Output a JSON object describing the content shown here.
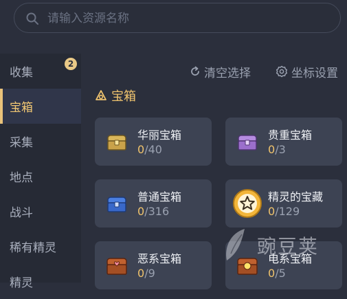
{
  "search": {
    "placeholder": "请输入资源名称",
    "value": ""
  },
  "sidebar": {
    "items": [
      {
        "label": "收集",
        "badge": "2"
      },
      {
        "label": "宝箱"
      },
      {
        "label": "采集"
      },
      {
        "label": "地点"
      },
      {
        "label": "战斗"
      },
      {
        "label": "稀有精灵"
      },
      {
        "label": "精灵"
      }
    ],
    "active_index": 1
  },
  "toolbar": {
    "clear_label": "清空选择",
    "coords_label": "坐标设置"
  },
  "section": {
    "title": "宝箱"
  },
  "cards": [
    {
      "name": "华丽宝箱",
      "found": "0",
      "total": "/40",
      "icon": "gold-chest-icon"
    },
    {
      "name": "贵重宝箱",
      "found": "0",
      "total": "/3",
      "icon": "purple-chest-icon"
    },
    {
      "name": "普通宝箱",
      "found": "0",
      "total": "/316",
      "icon": "blue-chest-icon"
    },
    {
      "name": "精灵的宝藏",
      "found": "0",
      "total": "/129",
      "icon": "star-coin-icon"
    },
    {
      "name": "恶系宝箱",
      "found": "0",
      "total": "/9",
      "icon": "dark-chest-icon"
    },
    {
      "name": "电系宝箱",
      "found": "0",
      "total": "/5",
      "icon": "electric-chest-icon"
    }
  ],
  "watermark": {
    "text": "豌豆荚"
  },
  "colors": {
    "accent": "#efc36e",
    "background": "#2b2f3c",
    "card": "#3d4353",
    "sidebar": "#262a35"
  }
}
